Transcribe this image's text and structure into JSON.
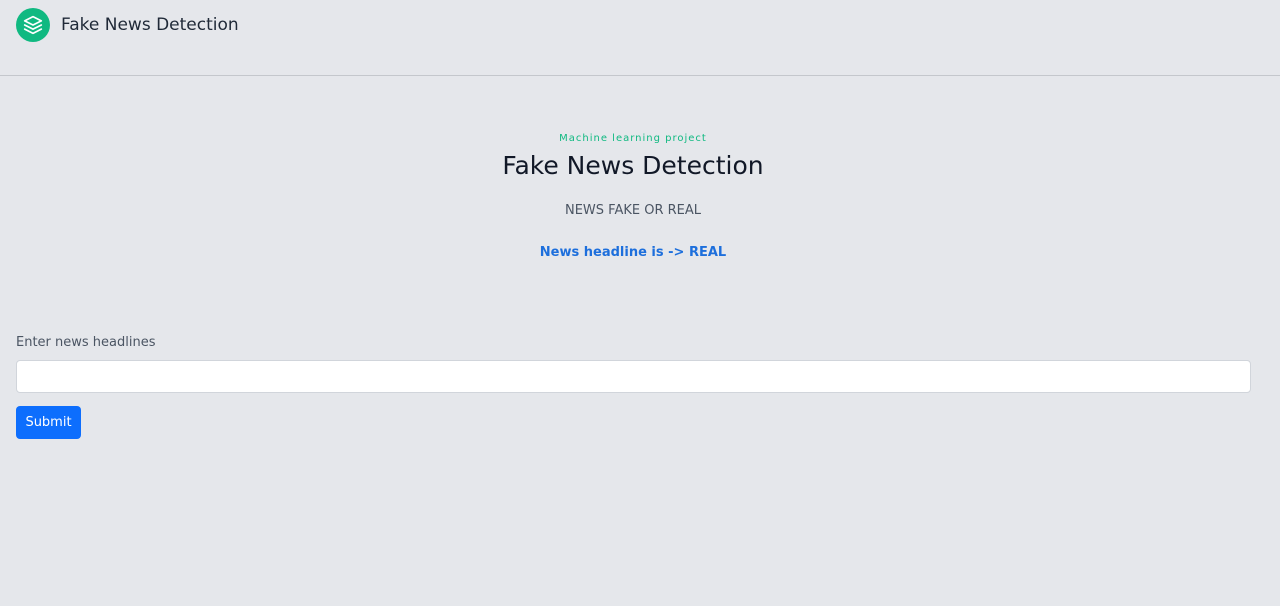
{
  "navbar": {
    "brand_title": "Fake News Detection",
    "logo_icon": "stacked-layers-icon"
  },
  "hero": {
    "eyebrow": "Machine learning project",
    "title": "Fake News Detection",
    "subtitle": "NEWS FAKE OR REAL",
    "result": "News headline is -> REAL"
  },
  "form": {
    "label": "Enter news headlines",
    "input_value": "",
    "input_placeholder": "",
    "submit_label": "Submit"
  },
  "colors": {
    "background": "#e5e7eb",
    "accent_green": "#10b981",
    "result_blue": "#1d6fdc",
    "button_blue": "#0d6efd"
  }
}
